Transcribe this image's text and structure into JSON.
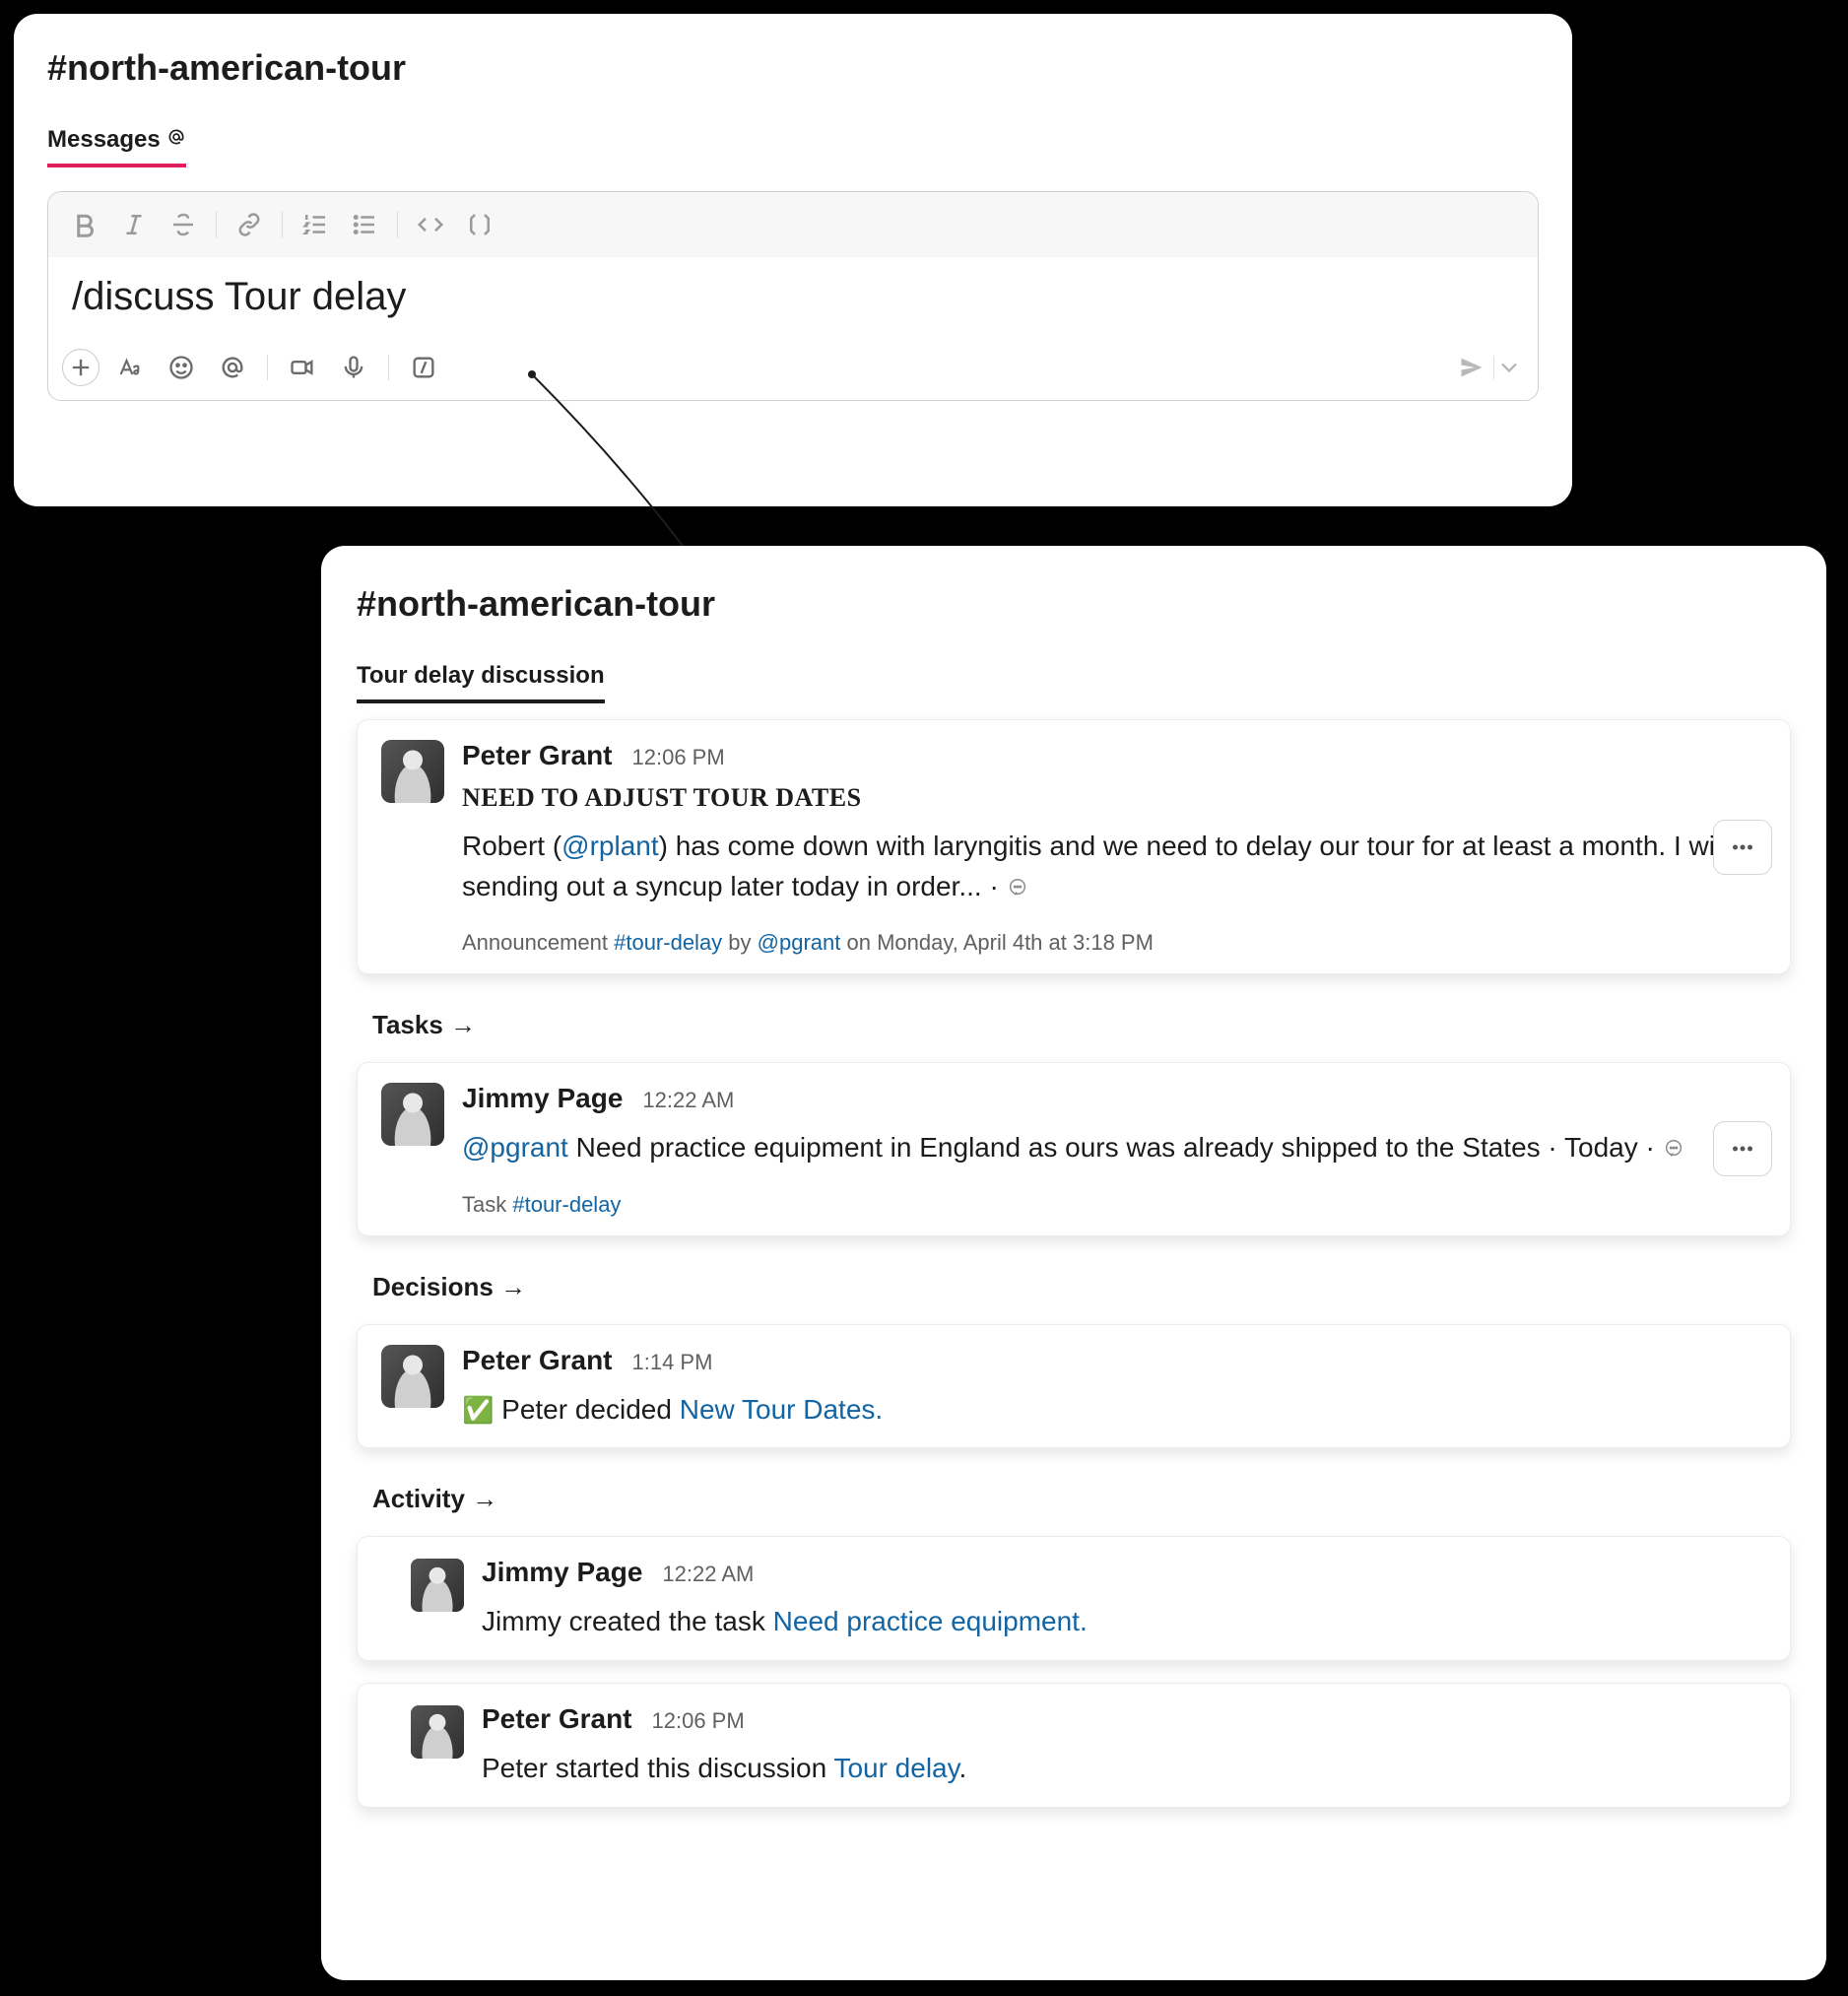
{
  "panel1": {
    "channel": "#north-american-tour",
    "tab_label": "Messages",
    "input_text": "/discuss Tour delay"
  },
  "panel2": {
    "channel": "#north-american-tour",
    "tab_label": "Tour delay discussion",
    "sections": {
      "tasks": "Tasks →",
      "decisions": "Decisions →",
      "activity": "Activity →"
    },
    "announcement": {
      "name": "Peter Grant",
      "time": "12:06 PM",
      "subject": "NEED TO ADJUST TOUR DATES",
      "pre": "Robert (",
      "mention": "@rplant",
      "post": ") has come down with laryngitis and we need to delay our tour for at least a month. I will be sending out a syncup later today in order...  · ",
      "meta_pre": "Announcement ",
      "meta_tag": "#tour-delay",
      "meta_mid": " by ",
      "meta_user": "@pgrant",
      "meta_post": " on Monday, April 4th at 3:18 PM"
    },
    "task": {
      "name": "Jimmy Page",
      "time": "12:22 AM",
      "mention": "@pgrant",
      "text_post": " Need practice equipment in England as ours was already shipped to the States  ·  Today  · ",
      "meta_pre": "Task ",
      "meta_tag": "#tour-delay"
    },
    "decision": {
      "name": "Peter Grant",
      "time": "1:14 PM",
      "prefix": " Peter decided ",
      "linktext": "New Tour Dates."
    },
    "activity1": {
      "name": "Jimmy Page",
      "time": "12:22 AM",
      "prefix": "Jimmy created the task ",
      "linktext": "Need practice equipment."
    },
    "activity2": {
      "name": "Peter Grant",
      "time": "12:06 PM",
      "prefix": "Peter started this discussion ",
      "linktext": "Tour delay",
      "suffix": "."
    }
  }
}
